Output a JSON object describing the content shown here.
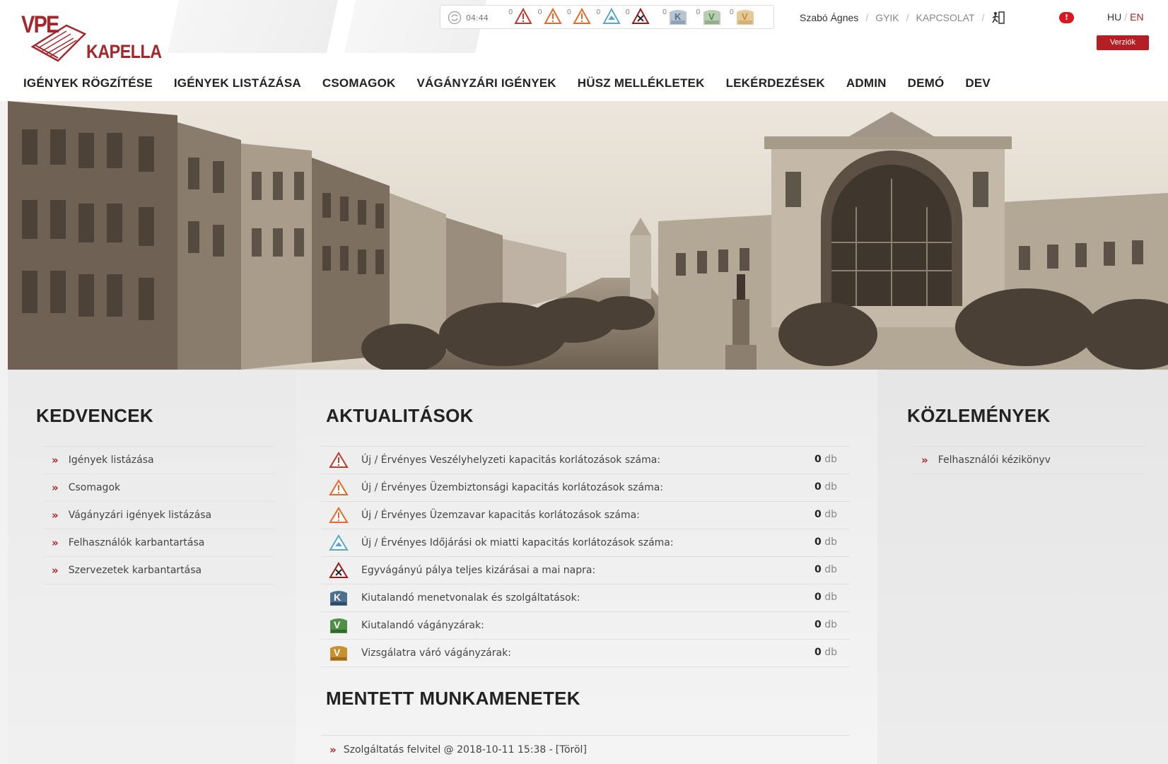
{
  "logo": {
    "vpe": "VPE",
    "name": "KAPELLA"
  },
  "status_bar": {
    "timer": "04:44",
    "counters": [
      {
        "icon": "warning-red-icon",
        "count": "0",
        "color": "#c0392b"
      },
      {
        "icon": "warning-orange-icon",
        "count": "0",
        "color": "#e8672a"
      },
      {
        "icon": "warning-orange-icon",
        "count": "0",
        "color": "#e8672a"
      },
      {
        "icon": "warning-blue-icon",
        "count": "0",
        "color": "#5aa8c8"
      },
      {
        "icon": "closure-icon",
        "count": "0",
        "color": "#9a1b1e"
      },
      {
        "icon": "k-husz-icon",
        "count": "0",
        "color": "#4e6f8f"
      },
      {
        "icon": "v-husz-icon",
        "count": "0",
        "color": "#4f8f47"
      },
      {
        "icon": "v-viz-icon",
        "count": "0",
        "color": "#c8912f"
      }
    ]
  },
  "user": {
    "name": "Szabó Ágnes",
    "links": [
      "GYIK",
      "KAPCSOLAT"
    ],
    "logout_icon": "logout-icon",
    "alert": "!"
  },
  "lang": {
    "hu": "HU",
    "sep": "/",
    "en": "EN"
  },
  "versions_button": "Verziók",
  "nav": [
    "IGÉNYEK RÖGZÍTÉSE",
    "IGÉNYEK LISTÁZÁSA",
    "CSOMAGOK",
    "VÁGÁNYZÁRI IGÉNYEK",
    "HÜSZ MELLÉKLETEK",
    "LEKÉRDEZÉSEK",
    "ADMIN",
    "DEMÓ",
    "DEV"
  ],
  "favorites": {
    "title": "KEDVENCEK",
    "items": [
      "Igények listázása",
      "Csomagok",
      "Vágányzári igények listázása",
      "Felhasználók karbantartása",
      "Szervezetek karbantartása"
    ]
  },
  "news": {
    "title": "AKTUALITÁSOK",
    "unit": "db",
    "rows": [
      {
        "icon": "warning-red-icon",
        "label": "Új / Érvényes Veszélyhelyzeti kapacitás korlátozások száma:",
        "count": "0"
      },
      {
        "icon": "warning-orange-icon",
        "label": "Új / Érvényes Üzembiztonsági kapacitás korlátozások száma:",
        "count": "0"
      },
      {
        "icon": "warning-orange-icon",
        "label": "Új / Érvényes Üzemzavar kapacitás korlátozások száma:",
        "count": "0"
      },
      {
        "icon": "warning-blue-icon",
        "label": "Új / Érvényes Időjárási ok miatti kapacitás korlátozások száma:",
        "count": "0"
      },
      {
        "icon": "closure-icon",
        "label": "Egyvágányú pálya teljes kizárásai a mai napra:",
        "count": "0"
      },
      {
        "icon": "k-husz-icon",
        "label": "Kiutalandó menetvonalak és szolgáltatások:",
        "count": "0"
      },
      {
        "icon": "v-husz-icon",
        "label": "Kiutalandó vágányzárak:",
        "count": "0"
      },
      {
        "icon": "v-viz-icon",
        "label": "Vizsgálatra váró vágányzárak:",
        "count": "0"
      }
    ]
  },
  "saved_sessions": {
    "title": "MENTETT MUNKAMENETEK",
    "items": [
      {
        "label": "Szolgáltatás felvitel @ 2018-10-11 15:38 - ",
        "action": "[Töröl]"
      }
    ]
  },
  "notices": {
    "title": "KÖZLEMÉNYEK",
    "items": [
      "Felhasználói kézikönyv"
    ]
  },
  "colors": {
    "brand": "#a3262a",
    "accent_red": "#b31f24",
    "alert": "#d9171e"
  }
}
